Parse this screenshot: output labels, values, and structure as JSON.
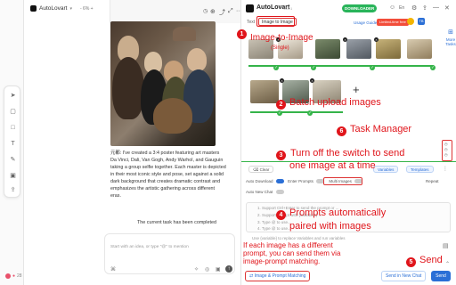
{
  "chat": {
    "tab_title": "AutoLovart",
    "zoom": "- 6% +",
    "message": "元都: I've created a 3:4 poster featuring art masters Da Vinci, Dali, Van Gogh, Andy Warhol, and Gauguin taking a group selfie together. Each master is depicted in their most iconic style and pose, set against a solid dark background that creates dramatic contrast and emphasizes the artistic gathering across different eras.",
    "task_done": "The current task has been completed",
    "prompt_placeholder": "Start with an idea, or type \"@\" to mention",
    "footer_count": "28"
  },
  "plugin": {
    "title": "AutoLovart",
    "version": "V0.0.1",
    "downloader": "DOWNLOADER",
    "tabs": {
      "text": "Text",
      "img": "Image to Image"
    },
    "usage": "Usage Guide",
    "limited": "Limited-time free",
    "side_more": "More Tasks",
    "chips": {
      "clear": "Clear",
      "variables": "Variables",
      "templates": "Templates"
    },
    "options": {
      "auto_download": "Auto Download",
      "enter_prompts": "Enter Prompts",
      "multi_images": "Multi Images",
      "repeat": "Repeat"
    },
    "auto_new_chat": "Auto New Chat",
    "prompt_lines": [
      "1. Support Ctrl+Enter to send the prompt or ...",
      "2. Support prompt with {variables} ...",
      "3. Type @ to use...",
      "4. Type @ to use..."
    ],
    "prompt_hint": "Use {variable} to replace Variables and run variables",
    "buttons": {
      "match": "Image & Prompt Matching",
      "new_chat": "Send in New Chat",
      "send": "Send"
    }
  },
  "annotations": {
    "a1": "Image-to-Image",
    "a1b": "(Single)",
    "a2": "Batch upload images",
    "a3": "Turn off the switch to send",
    "a3b": "one image at a time",
    "a4": "Prompts automatically",
    "a4b": "paired with images",
    "a5": "Send",
    "a6": "Task Manager",
    "a_bottom": "If each image has a different",
    "a_bottom2": "prompt, you can send them via",
    "a_bottom3": "image-prompt matching.",
    "n1": "1",
    "n2": "2",
    "n3": "3",
    "n4": "4",
    "n5": "5",
    "n6": "6"
  },
  "colors": {
    "accent": "#e0151b",
    "brand_blue": "#2b6fd6",
    "green": "#35b44a"
  }
}
